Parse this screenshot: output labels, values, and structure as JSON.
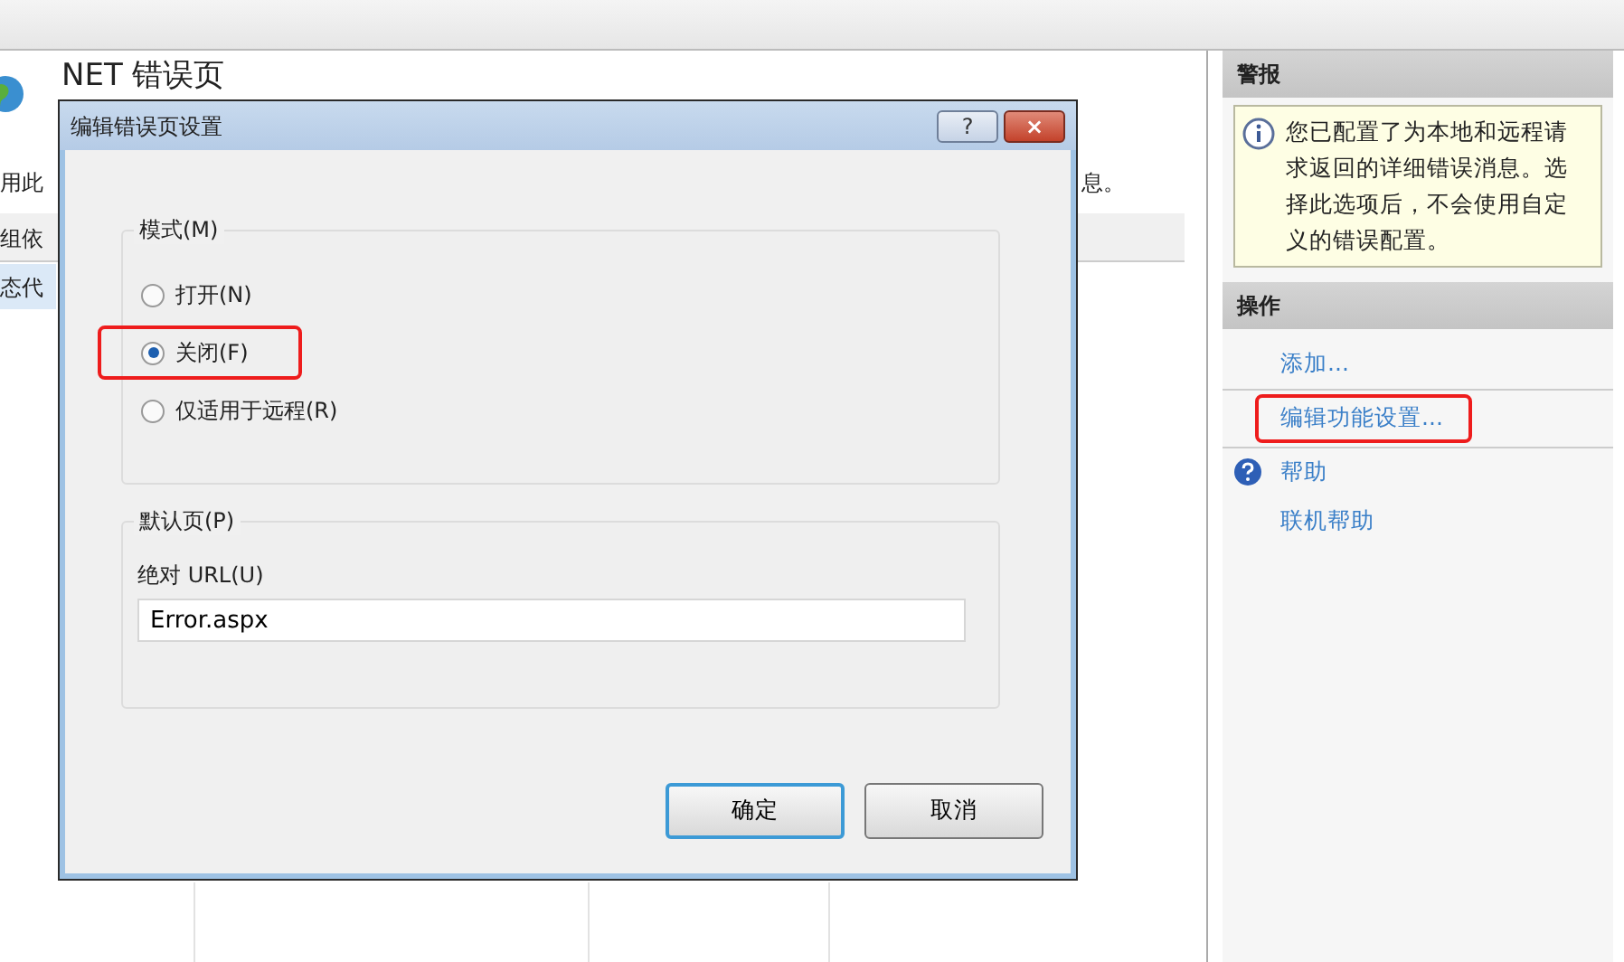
{
  "main": {
    "title": "NET 错误页",
    "description_start": "用此",
    "description_end": "息。",
    "columns": [
      "组依"
    ],
    "rows": [
      {
        "cells": [
          "态代"
        ],
        "selected": true
      }
    ]
  },
  "dialog": {
    "title": "编辑错误页设置",
    "help_button": "?",
    "close_button": "×",
    "mode": {
      "legend": "模式(M)",
      "options": [
        {
          "label": "打开(N)",
          "selected": false,
          "highlighted": false
        },
        {
          "label": "关闭(F)",
          "selected": true,
          "highlighted": true
        },
        {
          "label": "仅适用于远程(R)",
          "selected": false,
          "highlighted": false
        }
      ]
    },
    "default_page": {
      "legend": "默认页(P)",
      "field_label": "绝对 URL(U)",
      "value": "Error.aspx"
    },
    "buttons": [
      {
        "label": "确定",
        "default": true
      },
      {
        "label": "取消",
        "default": false
      }
    ]
  },
  "alerts": {
    "title": "警报",
    "message": "您已配置了为本地和远程请求返回的详细错误消息。选择此选项后，不会使用自定义的错误配置。"
  },
  "actions": {
    "title": "操作",
    "items": [
      {
        "label": "添加...",
        "kind": "link",
        "highlighted": false
      },
      {
        "label": "编辑功能设置...",
        "kind": "link",
        "highlighted": true
      },
      {
        "label": "帮助",
        "kind": "help",
        "highlighted": false
      },
      {
        "label": "联机帮助",
        "kind": "link",
        "highlighted": false
      }
    ]
  }
}
